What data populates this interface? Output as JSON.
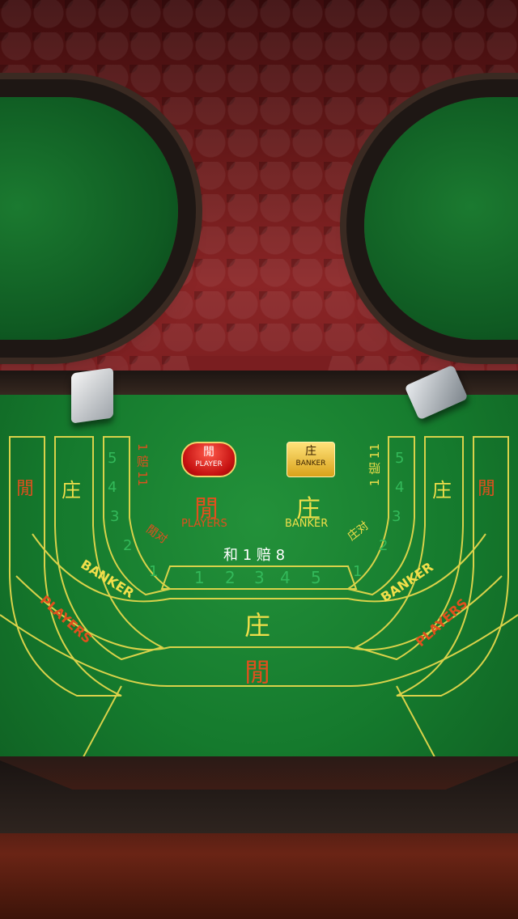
{
  "player_button": {
    "symbol": "閒",
    "label": "PLAYER"
  },
  "banker_button": {
    "symbol": "庄",
    "label": "BANKER"
  },
  "center": {
    "players_symbol": "閒",
    "players_label": "PLAYERS",
    "banker_symbol": "庄",
    "banker_label": "BANKER",
    "tie_text": "和 1 赔 8",
    "tie_numbers": [
      "1",
      "2",
      "3",
      "4",
      "5"
    ],
    "main_banker_symbol": "庄",
    "main_player_symbol": "閒"
  },
  "left": {
    "outer_symbol": "閒",
    "inner_symbol": "庄",
    "numbers": [
      "5",
      "4",
      "3",
      "2",
      "1"
    ],
    "odds": "1 赔 11",
    "pair": "閒对",
    "banker_arc": "BANKER",
    "players_arc": "PLAYERS"
  },
  "right": {
    "outer_symbol": "閒",
    "inner_symbol": "庄",
    "numbers": [
      "5",
      "4",
      "3",
      "2",
      "1"
    ],
    "odds": "1 赔 11",
    "pair": "庄对",
    "banker_arc": "BANKER",
    "players_arc": "PLAYERS"
  },
  "colors": {
    "felt": "#1a8533",
    "line": "#d9d24a",
    "orange": "#e0501d",
    "yellow": "#f1df4a"
  }
}
